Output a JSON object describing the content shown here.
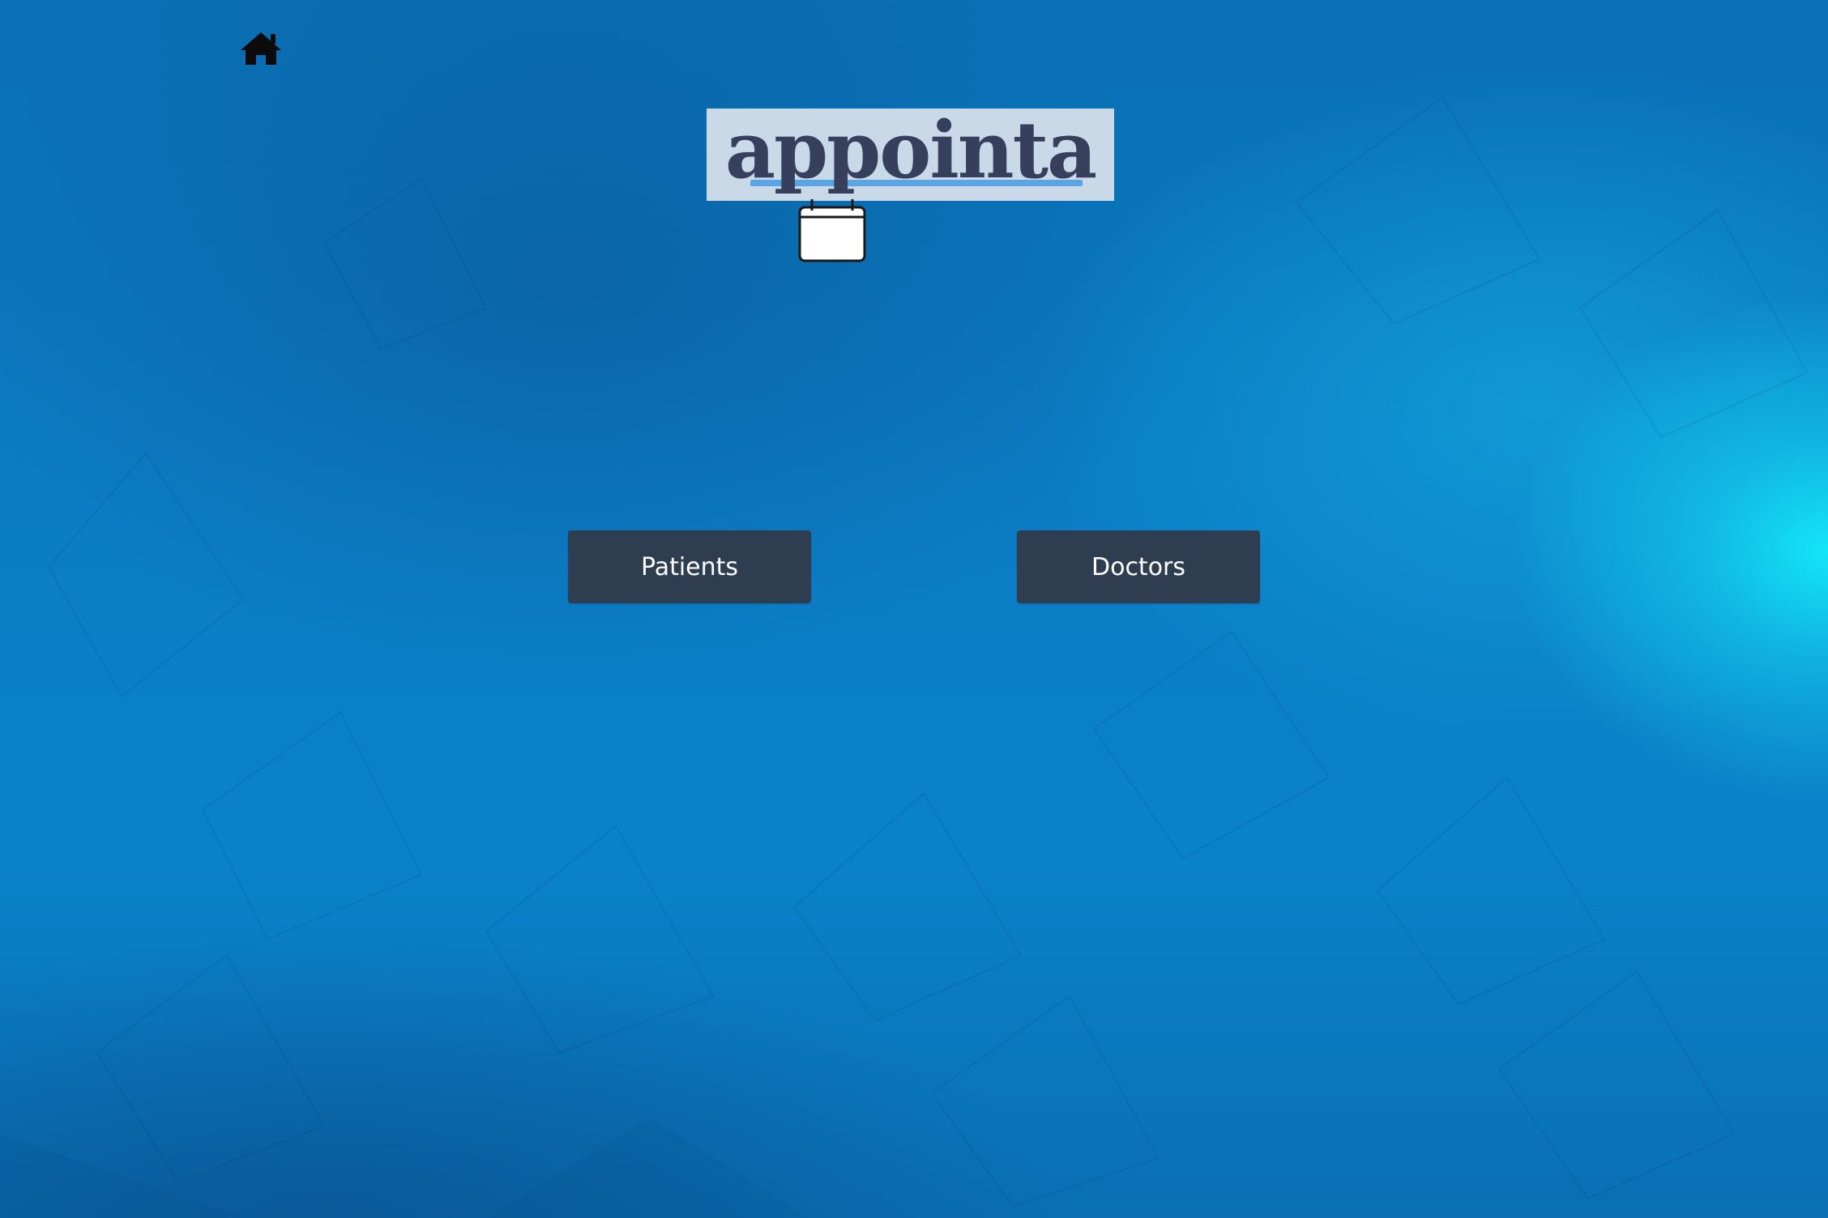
{
  "app": {
    "logo_text": "appointa"
  },
  "icons": {
    "home": "home-icon",
    "calendar": "calendar-icon"
  },
  "main": {
    "buttons": [
      {
        "label": "Patients"
      },
      {
        "label": "Doctors"
      }
    ]
  },
  "colors": {
    "background": "#0a7cc6",
    "glow": "#14ebfa",
    "button_bg": "#2e3d50",
    "button_text": "#ffffff",
    "logo_bg": "#c9d9e8",
    "logo_text": "#36405c",
    "logo_underline": "#5aa4e6"
  }
}
